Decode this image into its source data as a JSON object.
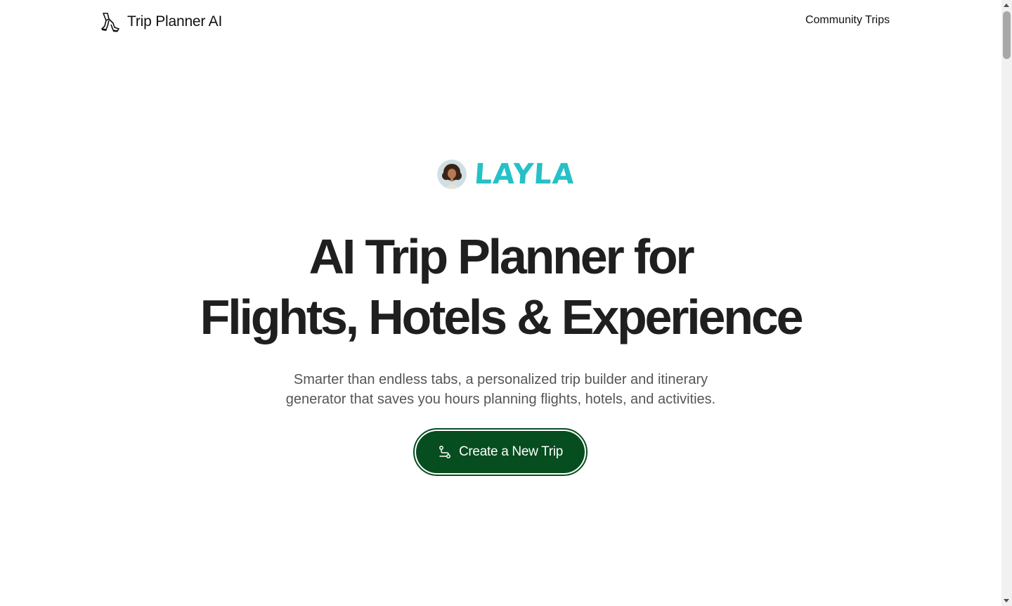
{
  "header": {
    "brand_name": "Trip Planner AI",
    "brand_icon": "walking-legs-icon",
    "nav": {
      "community_trips": "Community Trips"
    }
  },
  "hero": {
    "mascot_name": "LAYLA",
    "mascot_color": "#26c0c7",
    "headline_line1": "AI Trip Planner for",
    "headline_line2": "Flights, Hotels & Experience",
    "subtitle_line1": "Smarter than endless tabs, a personalized trip builder and itinerary",
    "subtitle_line2": "generator that saves you hours planning flights, hotels, and activities.",
    "cta_label": "Create a New Trip",
    "cta_icon": "route-icon",
    "cta_color": "#064d1f"
  }
}
